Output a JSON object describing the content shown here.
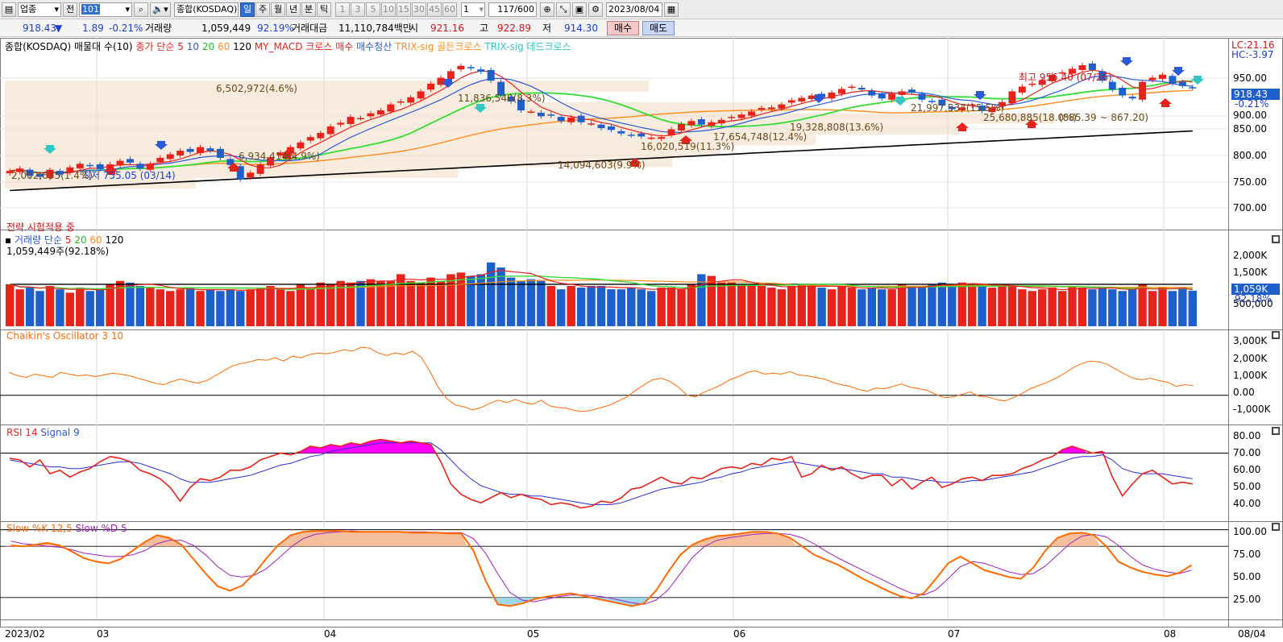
{
  "toolbar": {
    "category": "업종",
    "prev": "전",
    "code": "101",
    "market": "종합(KOSDAQ)",
    "periods": [
      "일",
      "주",
      "월",
      "년",
      "분",
      "틱"
    ],
    "active_period": "일",
    "intervals": [
      "1",
      "3",
      "5",
      "10",
      "15",
      "30",
      "45",
      "60"
    ],
    "count": "1",
    "ratio": "117/600",
    "date": "2023/08/04"
  },
  "quote": {
    "price": "918.43",
    "arrow": "▼",
    "change": "1.89",
    "change_pct": "-0.21%",
    "volume_label": "거래량",
    "volume": "1,059,449",
    "volume_pct": "92.19%",
    "amount_label": "거래대금",
    "amount": "11,110,784백만",
    "open_label": "시",
    "open": "921.16",
    "high_label": "고",
    "high": "922.89",
    "low_label": "저",
    "low": "914.30",
    "buy": "매수",
    "sell": "매도"
  },
  "price_panel": {
    "legend": {
      "title": "종합(KOSDAQ) 매물대 수(10)",
      "ma": "종가 단순",
      "ma_periods": [
        "5",
        "10",
        "20",
        "60",
        "120"
      ],
      "strategy1": "MY_MACD 크로스 매수",
      "strategy1b": "매수청산",
      "strategy2": "TRIX-sig 골든크로스",
      "strategy3": "TRIX-sig 데드크로스"
    },
    "lc": "LC:21.16",
    "hc": "HC:-3.97",
    "current": "918.43",
    "current_pct": "-0.21%",
    "yticks": [
      "950.00",
      "900.00",
      "850.00",
      "800.00",
      "750.00",
      "700.00"
    ],
    "strategy_note": "전략 시험적용 중",
    "annotations": {
      "high": "최고 956.40 (07/26)",
      "low": "최저 755.05 (03/14)",
      "range": "(885.39 ~ 867.20)",
      "vp": [
        "6,502,972(4.6%)",
        "11,836,540(8.3%)",
        "21,997,537(15.5%)",
        "25,680,885(18.0%)",
        "19,328,808(13.6%)",
        "17,654,748(12.4%)",
        "16,020,519(11.3%)",
        "14,094,603(9.9%)",
        "6,934,414(4.9%)",
        "2,002,635(1.4%)"
      ]
    }
  },
  "volume_panel": {
    "legend": {
      "title": "거래량",
      "ma": "단순",
      "periods": [
        "5",
        "20",
        "60",
        "120"
      ]
    },
    "subtitle": "1,059,449주(92.18%)",
    "current": "1,059K",
    "current_pct": "92.18%",
    "yticks": [
      "2,000K",
      "1,500K",
      "1,000K",
      "500,000"
    ]
  },
  "chaikin_panel": {
    "legend": "Chaikin's Oscillator 3 10",
    "yticks": [
      "3,000K",
      "2,000K",
      "1,000K",
      "0.00",
      "-1,000K"
    ]
  },
  "rsi_panel": {
    "legend_rsi": "RSI 14",
    "legend_signal": "Signal 9",
    "yticks": [
      "80.00",
      "70.00",
      "60.00",
      "50.00",
      "40.00"
    ]
  },
  "stoch_panel": {
    "legend_k": "Slow %K 12,5",
    "legend_d": "Slow %D 5",
    "yticks": [
      "100.00",
      "75.00",
      "50.00",
      "25.00"
    ]
  },
  "xaxis": {
    "ticks": [
      "2023/02",
      "03",
      "04",
      "05",
      "06",
      "07",
      "08"
    ],
    "end": "08/04"
  },
  "colors": {
    "up": "#e8231b",
    "down": "#1f5fcc",
    "ma5": "#e8231b",
    "ma10": "#2b59d9",
    "ma20": "#33dd33",
    "ma60": "#ff8c1a",
    "ma120": "#000000",
    "buy_arrow": "#e8231b",
    "sell_arrow": "#2b59d9",
    "golden": "#33c6c6"
  },
  "chart_data": {
    "type": "candlestick",
    "price_range": [
      690,
      975
    ],
    "closes": [
      778,
      782,
      770,
      768,
      780,
      772,
      784,
      790,
      786,
      781,
      789,
      795,
      792,
      782,
      790,
      800,
      806,
      812,
      810,
      818,
      812,
      800,
      788,
      764,
      775,
      789,
      801,
      809,
      818,
      826,
      835,
      842,
      853,
      859,
      869,
      867,
      875,
      880,
      890,
      895,
      902,
      912,
      925,
      935,
      946,
      955,
      951,
      945,
      930,
      905,
      895,
      880,
      878,
      870,
      871,
      862,
      868,
      860,
      858,
      850,
      847,
      841,
      838,
      836,
      834,
      835,
      848,
      857,
      862,
      856,
      860,
      864,
      869,
      873,
      878,
      884,
      885,
      890,
      897,
      901,
      905,
      902,
      910,
      916,
      920,
      915,
      905,
      900,
      908,
      912,
      910,
      898,
      895,
      888,
      882,
      885,
      890,
      879,
      884,
      894,
      912,
      920,
      925,
      931,
      940,
      944,
      950,
      956,
      948,
      930,
      915,
      905,
      900,
      928,
      935,
      940,
      925,
      921,
      918
    ],
    "volume_k": [
      1250,
      1100,
      1150,
      1050,
      1200,
      1100,
      1000,
      1150,
      1050,
      1100,
      1250,
      1350,
      1300,
      1200,
      1150,
      1100,
      1050,
      1100,
      1150,
      1050,
      1100,
      1050,
      1100,
      1050,
      1100,
      1150,
      1200,
      1100,
      1050,
      1250,
      1150,
      1300,
      1250,
      1350,
      1300,
      1350,
      1400,
      1350,
      1350,
      1550,
      1350,
      1300,
      1450,
      1350,
      1550,
      1600,
      1500,
      1550,
      1900,
      1750,
      1450,
      1350,
      1400,
      1350,
      1200,
      1100,
      1200,
      1150,
      1200,
      1200,
      1100,
      1100,
      1150,
      1100,
      1050,
      1150,
      1150,
      1100,
      1250,
      1550,
      1500,
      1300,
      1300,
      1250,
      1200,
      1200,
      1150,
      1100,
      1200,
      1250,
      1250,
      1150,
      1100,
      1200,
      1150,
      1100,
      1150,
      1100,
      1100,
      1250,
      1200,
      1150,
      1250,
      1300,
      1250,
      1300,
      1250,
      1200,
      1150,
      1250,
      1200,
      1100,
      1050,
      1100,
      1150,
      1050,
      1200,
      1150,
      1100,
      1150,
      1100,
      1050,
      1100,
      1250,
      1050,
      1150,
      1050,
      1150,
      1059
    ],
    "chaikin_k": [
      1400,
      1200,
      1100,
      1300,
      1200,
      1100,
      1400,
      1300,
      1200,
      1250,
      1150,
      1250,
      1350,
      1300,
      1200,
      1050,
      900,
      750,
      650,
      850,
      1000,
      850,
      750,
      900,
      1200,
      1500,
      1800,
      1950,
      2050,
      2200,
      2150,
      2300,
      2100,
      2400,
      2300,
      2500,
      2600,
      2550,
      2650,
      2800,
      2700,
      2950,
      2900,
      2600,
      2450,
      2600,
      2500,
      2700,
      2350,
      1500,
      500,
      -200,
      -600,
      -700,
      -900,
      -750,
      -500,
      -300,
      -450,
      -250,
      -450,
      -550,
      -300,
      -650,
      -750,
      -800,
      -950,
      -1000,
      -900,
      -750,
      -600,
      -350,
      -100,
      300,
      650,
      950,
      1050,
      850,
      500,
      0,
      -100,
      200,
      400,
      650,
      950,
      1150,
      1400,
      1500,
      1300,
      1350,
      1300,
      1450,
      1250,
      1200,
      1100,
      1000,
      800,
      650,
      550,
      350,
      250,
      450,
      400,
      550,
      700,
      500,
      400,
      300,
      50,
      -150,
      -100,
      50,
      200,
      -50,
      -100,
      -250,
      -350,
      -150,
      100,
      400,
      600,
      800,
      1050,
      1350,
      1700,
      1950,
      2100,
      2050,
      1900,
      1600,
      1300,
      1050,
      950,
      1050,
      900,
      800,
      550,
      650,
      600
    ],
    "rsi": [
      67,
      66,
      62,
      66,
      58,
      60,
      56,
      59,
      61,
      65,
      68,
      67,
      65,
      60,
      58,
      55,
      50,
      42,
      50,
      55,
      54,
      56,
      60,
      60,
      62,
      66,
      68,
      70,
      69,
      71,
      74,
      73,
      75,
      74,
      76,
      75,
      77,
      78,
      77,
      76,
      77,
      76,
      75,
      65,
      52,
      46,
      43,
      41,
      44,
      47,
      44,
      46,
      44,
      43,
      40,
      41,
      40,
      38,
      39,
      42,
      41,
      44,
      49,
      50,
      53,
      56,
      53,
      52,
      56,
      55,
      58,
      61,
      62,
      61,
      64,
      63,
      67,
      66,
      68,
      56,
      58,
      63,
      60,
      62,
      58,
      55,
      57,
      57,
      51,
      55,
      49,
      53,
      56,
      50,
      52,
      55,
      56,
      54,
      57,
      57,
      58,
      61,
      63,
      66,
      68,
      72,
      74,
      72,
      70,
      71,
      56,
      45,
      52,
      58,
      60,
      56,
      52,
      53,
      52
    ],
    "rsi_signal": [
      66,
      65,
      64,
      63,
      62,
      62,
      61,
      61,
      62,
      63,
      64,
      65,
      65,
      64,
      62,
      60,
      58,
      55,
      53,
      53,
      53,
      54,
      55,
      56,
      57,
      59,
      61,
      63,
      64,
      66,
      68,
      69,
      71,
      72,
      73,
      74,
      75,
      76,
      76,
      76,
      76,
      76,
      76,
      72,
      66,
      60,
      55,
      51,
      49,
      47,
      46,
      46,
      45,
      45,
      44,
      43,
      42,
      41,
      40,
      40,
      40,
      41,
      43,
      45,
      47,
      49,
      50,
      51,
      52,
      53,
      55,
      56,
      58,
      59,
      61,
      62,
      63,
      64,
      65,
      64,
      63,
      62,
      61,
      61,
      60,
      59,
      58,
      58,
      56,
      56,
      55,
      54,
      54,
      53,
      53,
      53,
      54,
      54,
      55,
      56,
      57,
      58,
      59,
      61,
      63,
      65,
      67,
      68,
      68,
      69,
      66,
      61,
      59,
      58,
      58,
      58,
      57,
      56,
      55
    ],
    "stoch_k": [
      81,
      80,
      82,
      84,
      81,
      74,
      66,
      62,
      60,
      65,
      75,
      85,
      93,
      90,
      82,
      65,
      48,
      33,
      28,
      34,
      48,
      66,
      82,
      93,
      97,
      98,
      98,
      98,
      97,
      97,
      97,
      97,
      97,
      96,
      96,
      96,
      95,
      95,
      75,
      40,
      12,
      10,
      13,
      18,
      21,
      23,
      25,
      22,
      19,
      16,
      13,
      10,
      13,
      28,
      50,
      70,
      82,
      88,
      92,
      93,
      95,
      97,
      97,
      95,
      90,
      80,
      70,
      64,
      58,
      50,
      42,
      35,
      28,
      22,
      19,
      25,
      42,
      60,
      68,
      60,
      52,
      48,
      44,
      42,
      55,
      75,
      90,
      95,
      96,
      93,
      80,
      62,
      55,
      50,
      47,
      45,
      49,
      58
    ],
    "stoch_d": [
      86,
      83,
      82,
      80,
      79,
      76,
      72,
      70,
      68,
      68,
      70,
      75,
      83,
      87,
      87,
      81,
      70,
      56,
      46,
      44,
      46,
      54,
      66,
      79,
      89,
      94,
      96,
      97,
      98,
      97,
      97,
      97,
      97,
      97,
      97,
      96,
      96,
      96,
      89,
      72,
      48,
      26,
      17,
      15,
      18,
      21,
      23,
      23,
      22,
      20,
      17,
      14,
      12,
      17,
      29,
      48,
      67,
      80,
      87,
      90,
      92,
      94,
      95,
      95,
      94,
      90,
      83,
      74,
      66,
      59,
      52,
      45,
      38,
      31,
      25,
      23,
      29,
      42,
      56,
      62,
      60,
      55,
      50,
      47,
      48,
      57,
      70,
      83,
      92,
      94,
      91,
      81,
      68,
      58,
      53,
      50,
      48,
      52
    ]
  }
}
